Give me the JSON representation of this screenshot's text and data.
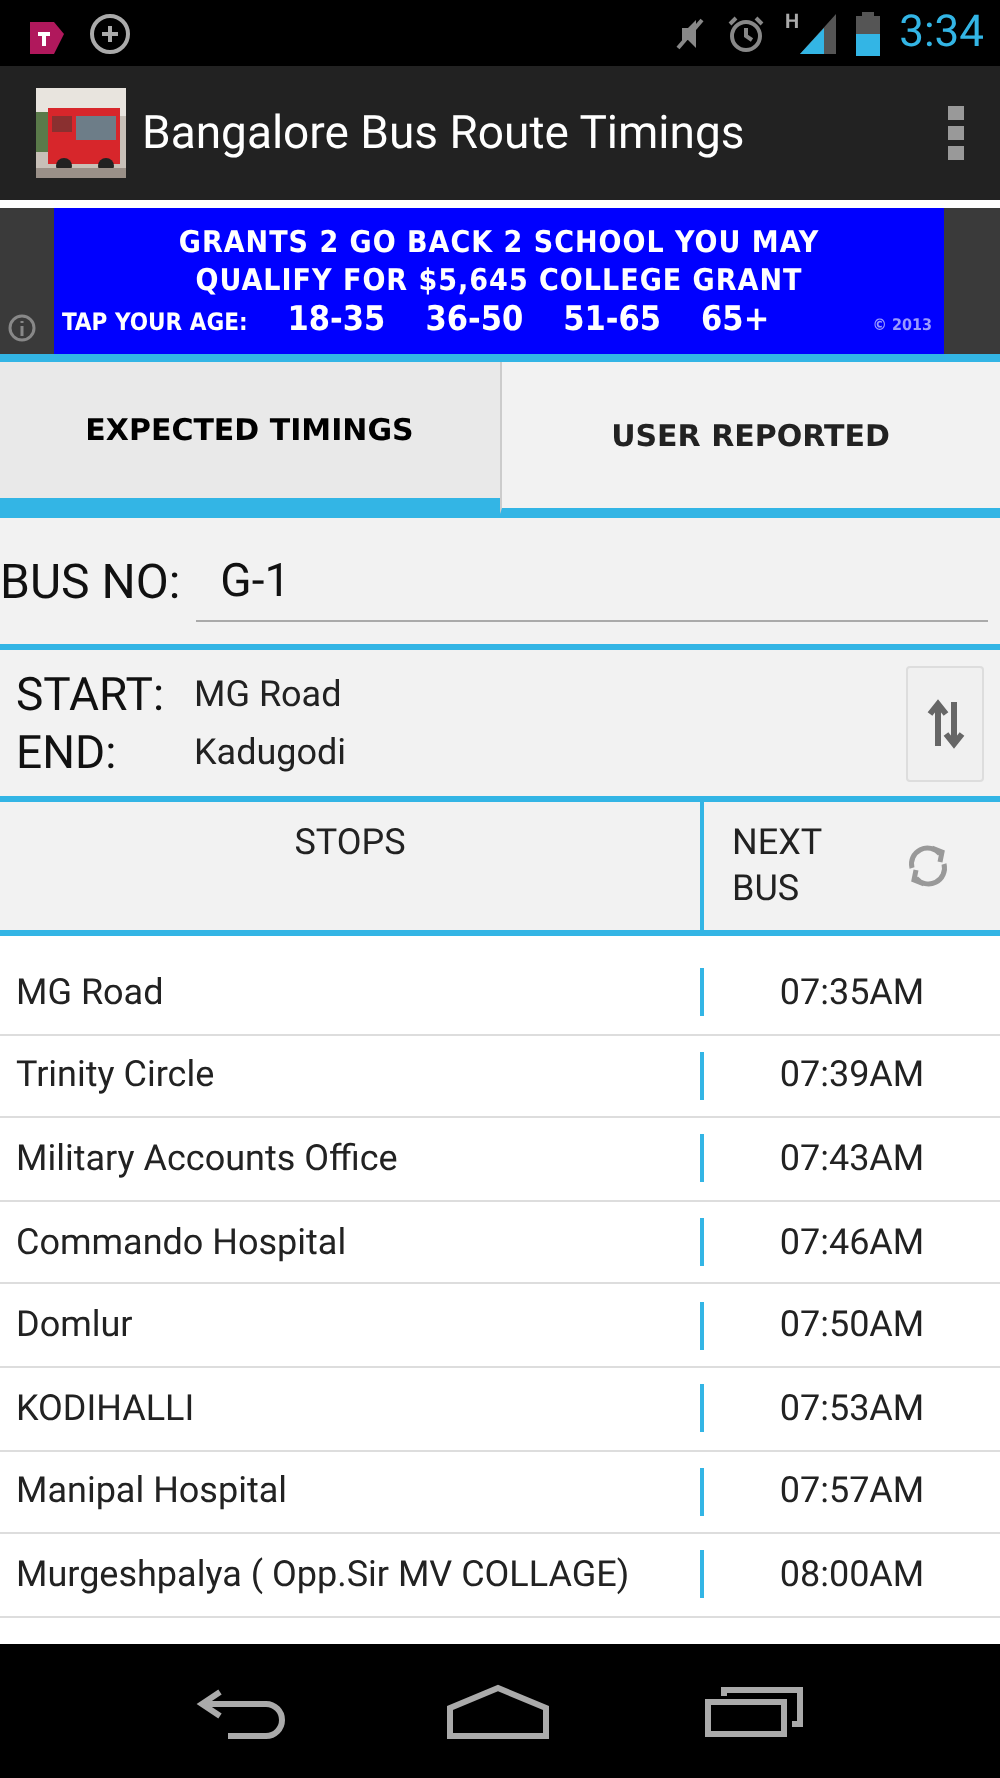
{
  "status_bar": {
    "network": "H",
    "time": "3:34"
  },
  "app_bar": {
    "title": "Bangalore Bus Route Timings"
  },
  "ad": {
    "lines": [
      "GRANTS 2 GO BACK 2 SCHOOL YOU MAY",
      "QUALIFY FOR $5,645 COLLEGE GRANT"
    ],
    "prompt": "TAP YOUR AGE:",
    "options": [
      "18-35",
      "36-50",
      "51-65",
      "65+"
    ],
    "copyright": "© 2013"
  },
  "tabs": [
    {
      "label": "EXPECTED TIMINGS",
      "selected": true
    },
    {
      "label": "USER REPORTED",
      "selected": false
    }
  ],
  "bus_no": {
    "label": "BUS NO:",
    "value": "G-1"
  },
  "route": {
    "start_label": "START:",
    "start": "MG Road",
    "end_label": "END:",
    "end": "Kadugodi"
  },
  "table": {
    "columns": [
      "STOPS",
      "NEXT BUS"
    ],
    "rows": [
      {
        "stop": "MG Road",
        "time": "07:35AM"
      },
      {
        "stop": "Trinity Circle",
        "time": "07:39AM"
      },
      {
        "stop": "Military Accounts Office",
        "time": "07:43AM"
      },
      {
        "stop": "Commando Hospital",
        "time": "07:46AM"
      },
      {
        "stop": "Domlur",
        "time": "07:50AM"
      },
      {
        "stop": "KODIHALLI",
        "time": "07:53AM"
      },
      {
        "stop": "Manipal Hospital",
        "time": "07:57AM"
      },
      {
        "stop": "Murgeshpalya ( Opp.Sir MV COLLAGE)",
        "time": "08:00AM"
      }
    ]
  }
}
